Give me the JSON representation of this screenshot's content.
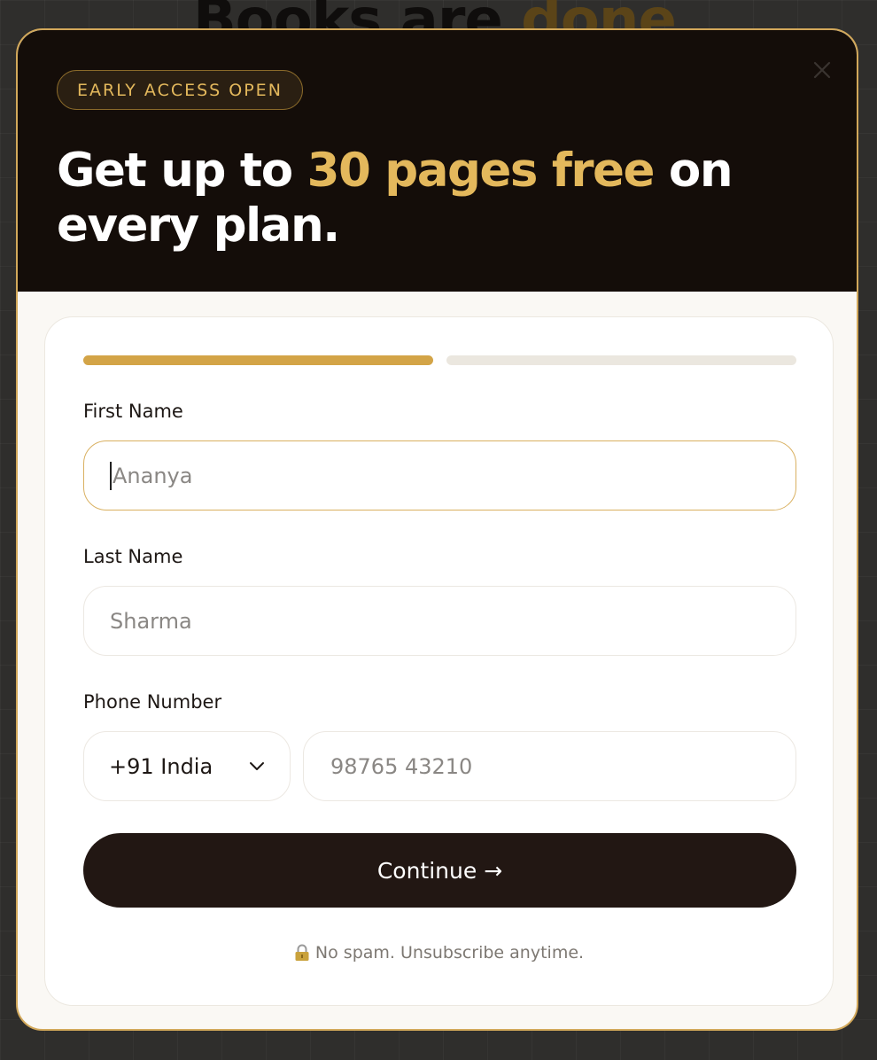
{
  "background": {
    "heading_main": "Books are ",
    "heading_accent": "done"
  },
  "modal": {
    "badge": "EARLY ACCESS OPEN",
    "headline_pre": "Get up to ",
    "headline_accent": "30 pages free",
    "headline_post": " on every plan.",
    "close_icon": "close-icon"
  },
  "progress": {
    "current_step": 1,
    "total_steps": 2
  },
  "form": {
    "first_name_label": "First Name",
    "first_name_placeholder": "Ananya",
    "last_name_label": "Last Name",
    "last_name_placeholder": "Sharma",
    "phone_label": "Phone Number",
    "country_selected": "+91 India",
    "phone_placeholder": "98765 43210",
    "continue_label": "Continue",
    "continue_arrow": "→",
    "footnote": "No spam. Unsubscribe anytime."
  },
  "colors": {
    "accent": "#d3a447",
    "header_bg": "#140d09",
    "button_bg": "#221713"
  }
}
